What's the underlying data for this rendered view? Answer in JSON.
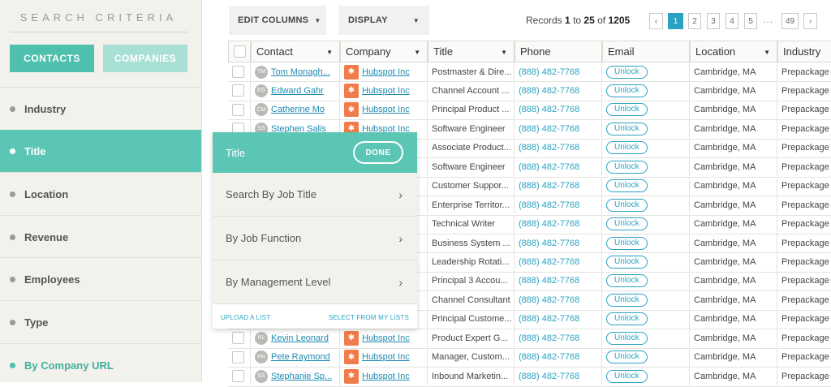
{
  "sidebar": {
    "title": "SEARCH CRITERIA",
    "tabs": {
      "contacts": "CONTACTS",
      "companies": "COMPANIES"
    },
    "criteria": [
      {
        "label": "Industry"
      },
      {
        "label": "Title"
      },
      {
        "label": "Location"
      },
      {
        "label": "Revenue"
      },
      {
        "label": "Employees"
      },
      {
        "label": "Type"
      },
      {
        "label": "By Company URL"
      }
    ]
  },
  "toolbar": {
    "edit_columns": "EDIT COLUMNS",
    "display": "DISPLAY",
    "records_prefix": "Records",
    "records_from": "1",
    "records_to_word": "to",
    "records_to": "25",
    "records_of_word": "of",
    "records_total": "1205"
  },
  "pagination": {
    "prev": "‹",
    "pages": [
      "1",
      "2",
      "3",
      "4",
      "5"
    ],
    "ellipsis": "...",
    "last": "49",
    "next": "›"
  },
  "table": {
    "columns": [
      "Contact",
      "Company",
      "Title",
      "Phone",
      "Email",
      "Location",
      "Industry"
    ],
    "rows": [
      {
        "initials": "TM",
        "contact": "Tom Monagh...",
        "company": "Hubspot Inc",
        "title": "Postmaster & Dire...",
        "phone": "(888) 482-7768",
        "email": "Unlock",
        "location": "Cambridge, MA",
        "industry": "Prepackage"
      },
      {
        "initials": "EG",
        "contact": "Edward Gahr",
        "company": "Hubspot Inc",
        "title": "Channel Account ...",
        "phone": "(888) 482-7768",
        "email": "Unlock",
        "location": "Cambridge, MA",
        "industry": "Prepackage"
      },
      {
        "initials": "CM",
        "contact": "Catherine Mo",
        "company": "Hubspot Inc",
        "title": "Principal Product ...",
        "phone": "(888) 482-7768",
        "email": "Unlock",
        "location": "Cambridge, MA",
        "industry": "Prepackage"
      },
      {
        "initials": "SS",
        "contact": "Stephen Salis",
        "company": "Hubspot Inc",
        "title": "Software Engineer",
        "phone": "(888) 482-7768",
        "email": "Unlock",
        "location": "Cambridge, MA",
        "industry": "Prepackage"
      },
      {
        "initials": "",
        "contact": "",
        "company": "",
        "title": "Associate Product...",
        "phone": "(888) 482-7768",
        "email": "Unlock",
        "location": "Cambridge, MA",
        "industry": "Prepackage"
      },
      {
        "initials": "",
        "contact": "",
        "company": "",
        "title": "Software Engineer",
        "phone": "(888) 482-7768",
        "email": "Unlock",
        "location": "Cambridge, MA",
        "industry": "Prepackage"
      },
      {
        "initials": "",
        "contact": "",
        "company": "",
        "title": "Customer Suppor...",
        "phone": "(888) 482-7768",
        "email": "Unlock",
        "location": "Cambridge, MA",
        "industry": "Prepackage"
      },
      {
        "initials": "",
        "contact": "",
        "company": "",
        "title": "Enterprise Territor...",
        "phone": "(888) 482-7768",
        "email": "Unlock",
        "location": "Cambridge, MA",
        "industry": "Prepackage"
      },
      {
        "initials": "",
        "contact": "",
        "company": "",
        "title": "Technical Writer",
        "phone": "(888) 482-7768",
        "email": "Unlock",
        "location": "Cambridge, MA",
        "industry": "Prepackage"
      },
      {
        "initials": "",
        "contact": "",
        "company": "",
        "title": "Business System ...",
        "phone": "(888) 482-7768",
        "email": "Unlock",
        "location": "Cambridge, MA",
        "industry": "Prepackage"
      },
      {
        "initials": "",
        "contact": "",
        "company": "",
        "title": "Leadership Rotati...",
        "phone": "(888) 482-7768",
        "email": "Unlock",
        "location": "Cambridge, MA",
        "industry": "Prepackage"
      },
      {
        "initials": "",
        "contact": "",
        "company": "",
        "title": "Principal 3 Accou...",
        "phone": "(888) 482-7768",
        "email": "Unlock",
        "location": "Cambridge, MA",
        "industry": "Prepackage"
      },
      {
        "initials": "",
        "contact": "",
        "company": "",
        "title": "Channel Consultant",
        "phone": "(888) 482-7768",
        "email": "Unlock",
        "location": "Cambridge, MA",
        "industry": "Prepackage"
      },
      {
        "initials": "",
        "contact": "",
        "company": "",
        "title": "Principal Custome...",
        "phone": "(888) 482-7768",
        "email": "Unlock",
        "location": "Cambridge, MA",
        "industry": "Prepackage"
      },
      {
        "initials": "KL",
        "contact": "Kevin Leonard",
        "company": "Hubspot Inc",
        "title": "Product Expert G...",
        "phone": "(888) 482-7768",
        "email": "Unlock",
        "location": "Cambridge, MA",
        "industry": "Prepackage"
      },
      {
        "initials": "PR",
        "contact": "Pete Raymond",
        "company": "Hubspot Inc",
        "title": "Manager, Custom...",
        "phone": "(888) 482-7768",
        "email": "Unlock",
        "location": "Cambridge, MA",
        "industry": "Prepackage"
      },
      {
        "initials": "SS",
        "contact": "Stephanie Sp...",
        "company": "Hubspot Inc",
        "title": "Inbound Marketin...",
        "phone": "(888) 482-7768",
        "email": "Unlock",
        "location": "Cambridge, MA",
        "industry": "Prepackage"
      }
    ]
  },
  "popup": {
    "title": "Title",
    "done": "DONE",
    "items": [
      "Search By Job Title",
      "By Job Function",
      "By Management Level"
    ],
    "upload": "UPLOAD A LIST",
    "select": "SELECT FROM MY LISTS"
  },
  "icons": {
    "chevron": "chevron-right-icon",
    "dropdown": "caret-down-icon",
    "company_logo": "hubspot-logo-icon"
  },
  "colors": {
    "accent": "#5cc6b5",
    "link": "#2aa3c2",
    "hubspot": "#f07c4b"
  }
}
